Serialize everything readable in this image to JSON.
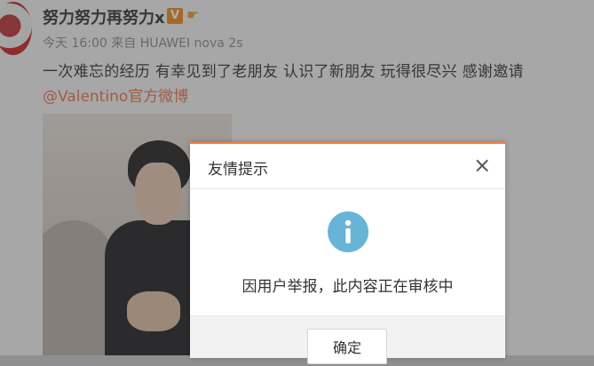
{
  "post": {
    "username": "努力努力再努力x",
    "vip_badge": "V",
    "meta": "今天 16:00 来自 HUAWEI nova 2s",
    "content": "一次难忘的经历 有幸见到了老朋友 认识了新朋友 玩得很尽兴 感谢邀请",
    "mention": "@Valentino官方微博"
  },
  "dialog": {
    "title": "友情提示",
    "close": "×",
    "message": "因用户举报，此内容正在审核中",
    "confirm_label": "确定"
  },
  "colors": {
    "accent": "#fa7d3c",
    "mention": "#eb7350",
    "info_icon": "#68b4d6"
  }
}
